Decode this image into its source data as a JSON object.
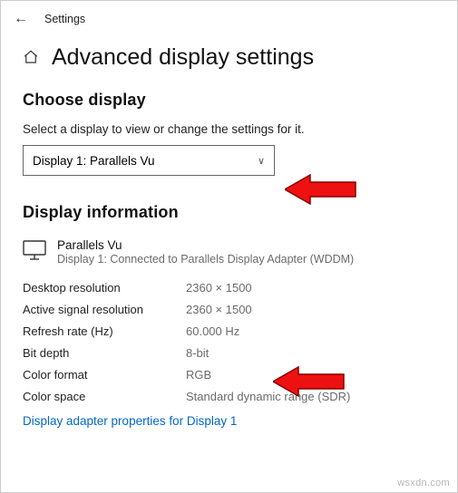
{
  "titlebar": {
    "title": "Settings"
  },
  "page": {
    "heading": "Advanced display settings"
  },
  "choose": {
    "heading": "Choose display",
    "description": "Select a display to view or change the settings for it.",
    "selected": "Display 1: Parallels Vu"
  },
  "info": {
    "heading": "Display information",
    "monitor_name": "Parallels Vu",
    "monitor_sub": "Display 1: Connected to Parallels Display Adapter (WDDM)",
    "specs": [
      {
        "label": "Desktop resolution",
        "value": "2360 × 1500"
      },
      {
        "label": "Active signal resolution",
        "value": "2360 × 1500"
      },
      {
        "label": "Refresh rate (Hz)",
        "value": "60.000 Hz"
      },
      {
        "label": "Bit depth",
        "value": "8-bit"
      },
      {
        "label": "Color format",
        "value": "RGB"
      },
      {
        "label": "Color space",
        "value": "Standard dynamic range (SDR)"
      }
    ],
    "link": "Display adapter properties for Display 1"
  },
  "watermark": "wsxdn.com"
}
